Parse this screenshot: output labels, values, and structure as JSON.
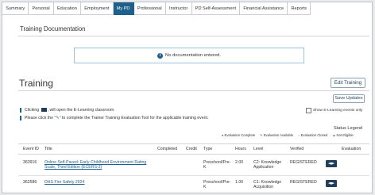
{
  "tabs": [
    "Summary",
    "Personal",
    "Education",
    "Employment",
    "My PD",
    "Professional",
    "Instructor",
    "PD Self-Assessment",
    "Financial Assistance",
    "Reports"
  ],
  "active_tab": "My PD",
  "doc_section": {
    "title": "Training Documentation",
    "notice": "No documentation entered."
  },
  "training": {
    "title": "Training",
    "edit_button": "Edit Training",
    "save_button": "Save Updates",
    "help_line1_pre": "Clicking",
    "help_line1_post": ", will open the E-Learning classroom.",
    "help_line2_pre": "Please click the \"",
    "help_line2_post": "\" to complete the Trainer Training Evaluation Tool for the applicable training event.",
    "elearning_checkbox": "Show E-Learning events only"
  },
  "legend": {
    "title": "Status Legend",
    "items": [
      {
        "mark": "●",
        "label": "Evaluation Complete",
        "color": "#2e8b57"
      },
      {
        "mark": "✎",
        "label": "Evaluation Available",
        "color": "#1f5f8b"
      },
      {
        "mark": "○",
        "label": "Evaluation Closed",
        "color": "#c0392b"
      },
      {
        "mark": "▲",
        "label": "Not Eligible",
        "color": "#555555"
      }
    ]
  },
  "table": {
    "headers": [
      "Event ID",
      "Title",
      "Completed",
      "Credit",
      "Type",
      "Hours",
      "Level",
      "Verified",
      "Evaluation"
    ],
    "rows": [
      {
        "id": "363916",
        "title": "Online Self-Paced: Early Childhood Environment Rating Scale, Third Edition (ECERS-3)",
        "completed": "",
        "credit": "",
        "type": "Preschool/Pre-K",
        "hours": "2.00",
        "level": "C2: Knowledge Application",
        "verified": "REGISTERED"
      },
      {
        "id": "362586",
        "title": "DHS Fire Safety 2024",
        "completed": "",
        "credit": "",
        "type": "Preschool/Pre-K",
        "hours": "1.00",
        "level": "C1: Knowledge Acquisition",
        "verified": "REGISTERED"
      }
    ]
  }
}
